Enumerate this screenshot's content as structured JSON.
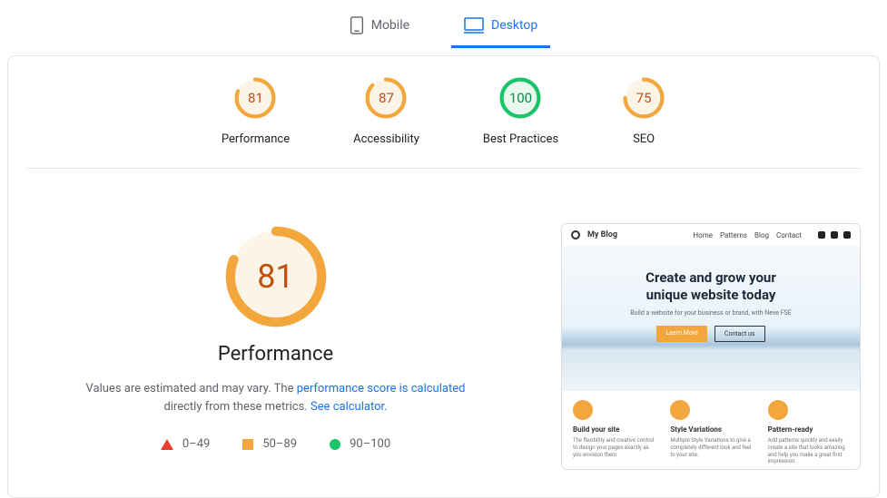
{
  "tabs": {
    "mobile": "Mobile",
    "desktop": "Desktop",
    "active": "desktop"
  },
  "colors": {
    "mid": "#f2a63c",
    "mid_text": "#c24f0c",
    "mid_bg": "#fdf4e8",
    "good": "#1cc36a",
    "good_text": "#0d8a47",
    "good_bg": "#e9f8ef"
  },
  "gauges": [
    {
      "score": 81,
      "label": "Performance",
      "tier": "mid"
    },
    {
      "score": 87,
      "label": "Accessibility",
      "tier": "mid"
    },
    {
      "score": 100,
      "label": "Best Practices",
      "tier": "good"
    },
    {
      "score": 75,
      "label": "SEO",
      "tier": "mid"
    }
  ],
  "performance": {
    "main_score": 81,
    "title": "Performance",
    "desc_pre": "Values are estimated and may vary. The ",
    "desc_link1": "performance score is calculated",
    "desc_mid": " directly from these metrics. ",
    "desc_link2": "See calculator.",
    "legend": {
      "bad": "0–49",
      "mid": "50–89",
      "good": "90–100"
    }
  },
  "preview": {
    "site_title": "My Blog",
    "nav": [
      "Home",
      "Patterns",
      "Blog",
      "Contact"
    ],
    "hero_title_l1": "Create and grow your",
    "hero_title_l2": "unique website today",
    "hero_sub": "Build a website for your business or brand, with Neve FSE",
    "btn_primary": "Learn More",
    "btn_outline": "Contact us",
    "cards": [
      {
        "title": "Build your site",
        "desc": "The flexibility and creative control to design your pages exactly as you envision them"
      },
      {
        "title": "Style Variations",
        "desc": "Multiple Style Variations to give a completely different look and feel to your site."
      },
      {
        "title": "Pattern-ready",
        "desc": "Add patterns quickly and easily create a site that looks amazing and help you make a great first impression."
      }
    ]
  }
}
